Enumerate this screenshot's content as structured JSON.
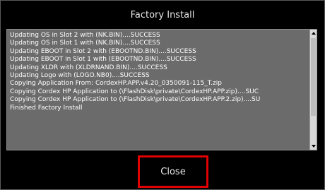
{
  "window": {
    "title": "Factory Install"
  },
  "log": {
    "lines": [
      "Updating OS in Slot 2 with (NK.BIN)....SUCCESS",
      "Updating OS in Slot 1 with (NK.BIN)....SUCCESS",
      "Updating EBOOT in Slot 2 with (EBOOTND.BIN)....SUCCESS",
      "Updating EBOOT in Slot 1 with (EBOOTND.BIN)....SUCCESS",
      "Updating XLDR with (XLDRNAND.BIN)....SUCCESS",
      "Updating Logo with (LOGO.NB0)....SUCCESS",
      "Copying Application From: CordexHP.APP.v4.20_0350091-115_T.zip",
      "Copying Cordex HP Application to (\\FlashDisk\\private\\CordexHP.APP.zip)....SUC",
      "Copying Cordex HP Application to (\\FlashDisk\\private\\CordexHP.APP.2.zip)....SU",
      "Finished Factory Install"
    ]
  },
  "footer": {
    "close_label": "Close"
  },
  "icons": {
    "scroll_up": "scroll-up-arrow-icon",
    "scroll_down": "scroll-down-arrow-icon"
  },
  "colors": {
    "background": "#000000",
    "log_background": "#6b6b6b",
    "text": "#ffffff",
    "close_highlight": "#e00000"
  }
}
